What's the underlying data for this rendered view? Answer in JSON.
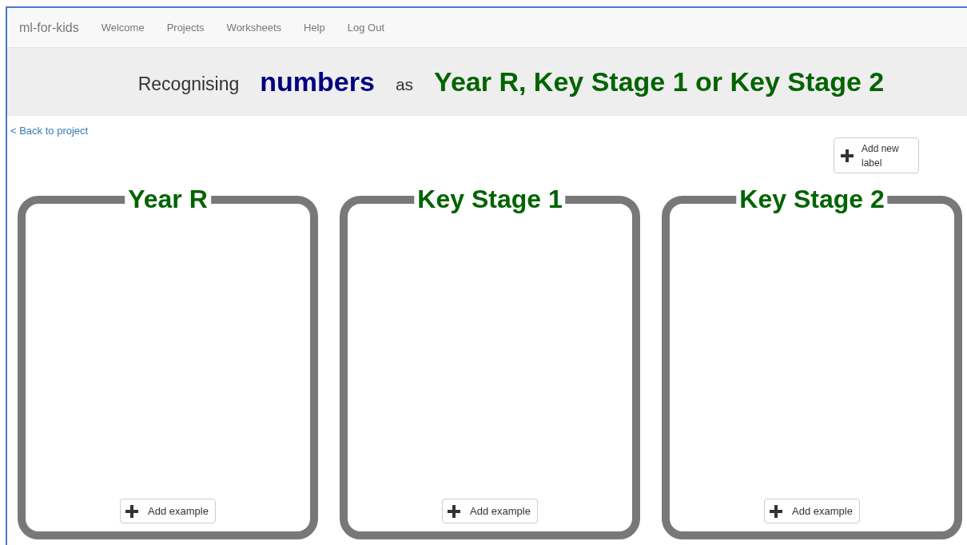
{
  "nav": {
    "brand": "ml-for-kids",
    "items": [
      "Welcome",
      "Projects",
      "Worksheets",
      "Help",
      "Log Out"
    ]
  },
  "header": {
    "prefix": "Recognising",
    "type": "numbers",
    "joiner": "as",
    "labels": "Year R, Key Stage 1 or Key Stage 2"
  },
  "back_link": "< Back to project",
  "add_label_button": {
    "text": "Add new label"
  },
  "labels": [
    {
      "name": "Year R",
      "button": "Add example"
    },
    {
      "name": "Key Stage 1",
      "button": "Add example"
    },
    {
      "name": "Key Stage 2",
      "button": "Add example"
    }
  ]
}
